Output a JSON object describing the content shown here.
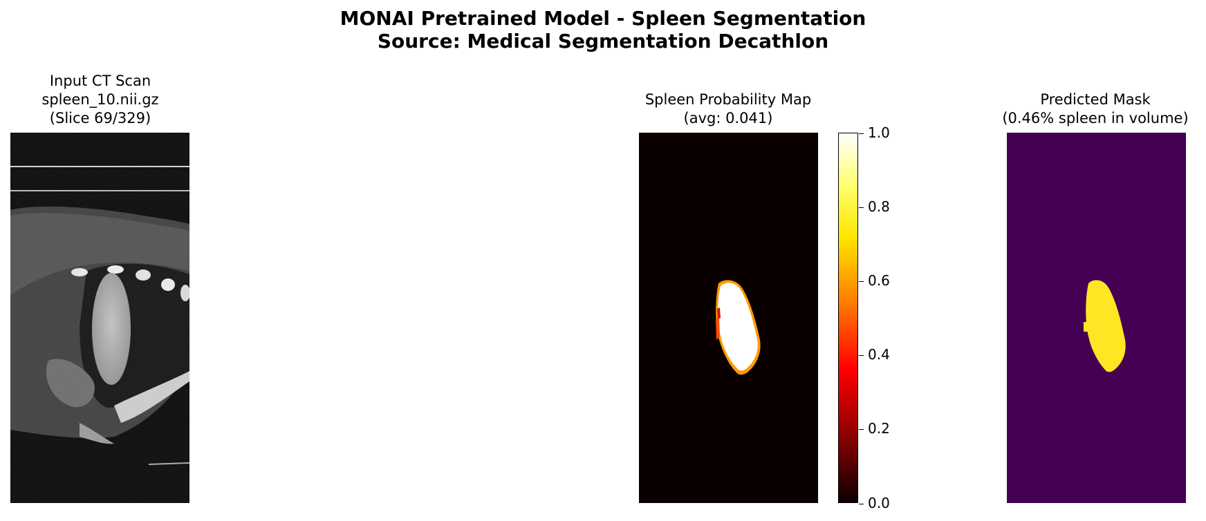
{
  "figure": {
    "title_line1": "MONAI Pretrained Model - Spleen Segmentation",
    "title_line2": "Source: Medical Segmentation Decathlon"
  },
  "panels": [
    {
      "title_lines": [
        "Input CT Scan",
        "spleen_10.nii.gz",
        "(Slice 69/329)"
      ],
      "colormap": "gray"
    },
    {
      "title_lines": [
        "Spleen Probability Map",
        "(avg: 0.041)"
      ],
      "colormap": "hot"
    },
    {
      "title_lines": [
        "Predicted Mask",
        "(0.46% spleen in volume)"
      ],
      "colormap": "viridis"
    }
  ],
  "colorbar": {
    "ticks": [
      "1.0",
      "0.8",
      "0.6",
      "0.4",
      "0.2",
      "0.0"
    ],
    "range": [
      0.0,
      1.0
    ],
    "colormap": "hot"
  },
  "colors": {
    "prob_background": "#0b0000",
    "mask_background": "#440154",
    "mask_foreground": "#fde725"
  }
}
